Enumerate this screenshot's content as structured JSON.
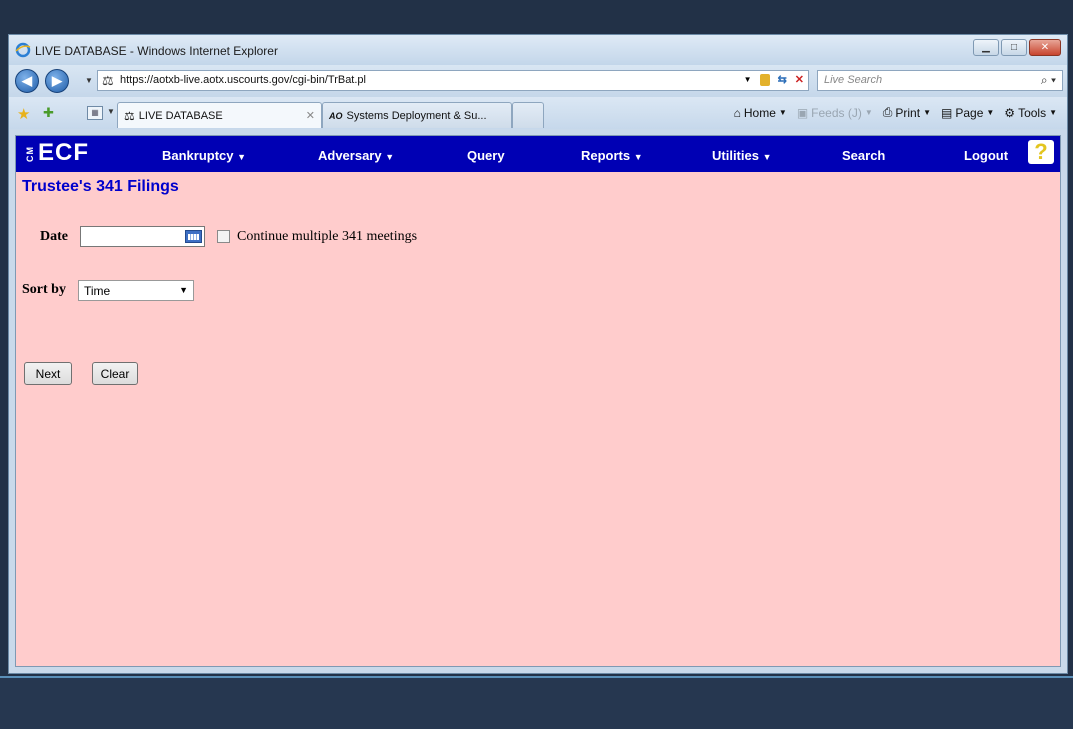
{
  "browser": {
    "window_title": "LIVE DATABASE - Windows Internet Explorer",
    "url": "https://aotxb-live.aotx.uscourts.gov/cgi-bin/TrBat.pl",
    "search_placeholder": "Live Search",
    "tabs": [
      {
        "label": "LIVE DATABASE",
        "active": true
      },
      {
        "label": "Systems Deployment & Su...",
        "active": false
      }
    ],
    "commands": {
      "home": "Home",
      "feeds": "Feeds (J)",
      "print": "Print",
      "page": "Page",
      "tools": "Tools"
    }
  },
  "ecf": {
    "logo": "ECF",
    "logo_prefix": "CM",
    "menu": [
      {
        "label": "Bankruptcy",
        "dropdown": true
      },
      {
        "label": "Adversary",
        "dropdown": true
      },
      {
        "label": "Query",
        "dropdown": false
      },
      {
        "label": "Reports",
        "dropdown": true
      },
      {
        "label": "Utilities",
        "dropdown": true
      },
      {
        "label": "Search",
        "dropdown": false
      },
      {
        "label": "Logout",
        "dropdown": false
      }
    ],
    "help_glyph": "?"
  },
  "page": {
    "title": "Trustee's 341 Filings",
    "date_label": "Date",
    "date_value": "",
    "continue_label": "Continue multiple 341 meetings",
    "continue_checked": false,
    "sort_label": "Sort by",
    "sort_value": "Time",
    "next_button": "Next",
    "clear_button": "Clear"
  },
  "colors": {
    "menu_bar": "#0000b4",
    "page_background": "#ffcccc",
    "title_color": "#0000cc"
  }
}
